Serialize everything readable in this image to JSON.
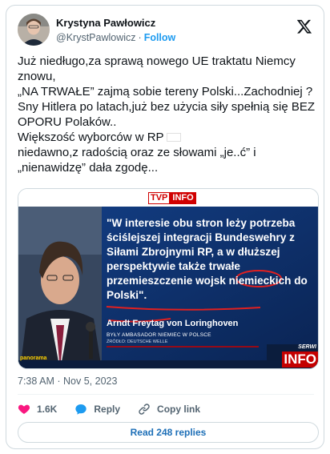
{
  "author": {
    "name": "Krystyna Pawłowicz",
    "handle": "@KrystPawlowicz",
    "separator": "·",
    "follow_label": "Follow"
  },
  "tweet": {
    "lines": [
      "Już niedługo,za sprawą nowego UE traktatu Niemcy znowu,",
      "„NA TRWAŁE” zajmą sobie tereny Polski...Zachodniej ?",
      "Sny Hitlera po latach,już bez użycia siły spełnią się BEZ OPORU Polaków..",
      "Większość wyborców w RP",
      "niedawno,z radością oraz ze słowami „je..ć” i „nienawidzę” dała zgodę..."
    ]
  },
  "media": {
    "logo_tvp": "TVP",
    "logo_info": "INFO",
    "quote": "\"W interesie obu stron leży potrzeba ściślejszej integracji Bundeswehry z Siłami Zbrojnymi RP, a w dłuższej perspektywie także trwałe przemieszczenie wojsk niemieckich do Polski\".",
    "caption_name": "Arndt Freytag von Loringhoven",
    "caption_role": "BYŁY AMBASADOR NIEMIEC W POLSCE",
    "caption_source": "ŹRÓDŁO: DEUTSCHE WELLE",
    "channel_tag": "panorama",
    "serwis": "SERWI",
    "info_big": "INFO"
  },
  "meta": {
    "time": "7:38 AM",
    "separator": "·",
    "date": "Nov 5, 2023"
  },
  "actions": {
    "likes": "1.6K",
    "reply_label": "Reply",
    "copy_label": "Copy link"
  },
  "read_replies_label": "Read 248 replies",
  "colors": {
    "accent": "#1d9bf0",
    "like": "#f91880",
    "tvp_blue": "#0c2a5c",
    "tvp_red": "#d00000"
  }
}
